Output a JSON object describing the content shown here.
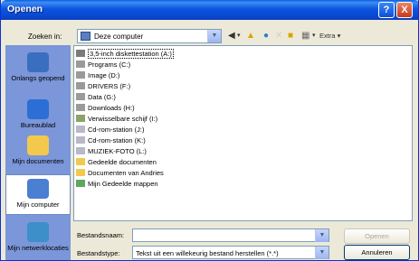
{
  "window": {
    "title": "Openen",
    "help_label": "?",
    "close_label": "X"
  },
  "lookin": {
    "label": "Zoeken in:",
    "value": "Deze computer"
  },
  "toolbar": {
    "extra_label": "Extra ▾"
  },
  "places": [
    {
      "label": "Onlangs geopend",
      "icon": "recent-icon",
      "color": "#3a6fbf"
    },
    {
      "label": "Bureaublad",
      "icon": "desktop-icon",
      "color": "#2b6fd6"
    },
    {
      "label": "Mijn documenten",
      "icon": "folder-icon",
      "color": "#f2c94c"
    },
    {
      "label": "Mijn computer",
      "icon": "computer-icon",
      "color": "#4a7fd1"
    },
    {
      "label": "Mijn netwerklocaties",
      "icon": "network-icon",
      "color": "#3c8fc8"
    }
  ],
  "files": [
    {
      "label": "3,5-inch diskettestation (A:)",
      "icon": "floppy-icon",
      "color": "#7a7a7a"
    },
    {
      "label": "Programs (C:)",
      "icon": "drive-icon",
      "color": "#9a9a9a"
    },
    {
      "label": "Image (D:)",
      "icon": "drive-icon",
      "color": "#9a9a9a"
    },
    {
      "label": "DRIVERS (F:)",
      "icon": "drive-icon",
      "color": "#9a9a9a"
    },
    {
      "label": "Data (G:)",
      "icon": "drive-icon",
      "color": "#9a9a9a"
    },
    {
      "label": "Downloads (H:)",
      "icon": "drive-icon",
      "color": "#9a9a9a"
    },
    {
      "label": "Verwisselbare schijf (I:)",
      "icon": "removable-drive-icon",
      "color": "#8aa36a"
    },
    {
      "label": "Cd-rom-station (J:)",
      "icon": "cdrom-icon",
      "color": "#b8b8c8"
    },
    {
      "label": "Cd-rom-station (K:)",
      "icon": "cdrom-icon",
      "color": "#b8b8c8"
    },
    {
      "label": "MUZIEK-FOTO (L:)",
      "icon": "cdrom-icon",
      "color": "#b8b8c8"
    },
    {
      "label": "Gedeelde documenten",
      "icon": "folder-icon",
      "color": "#f2c94c"
    },
    {
      "label": "Documenten van Andries",
      "icon": "folder-icon",
      "color": "#f2c94c"
    },
    {
      "label": "Mijn Gedeelde mappen",
      "icon": "shared-folder-icon",
      "color": "#5ea85e"
    }
  ],
  "filename": {
    "label": "Bestandsnaam:",
    "value": ""
  },
  "filetype": {
    "label": "Bestandstype:",
    "value": "Tekst uit een willekeurig bestand herstellen (*.*)"
  },
  "buttons": {
    "open": "Openen",
    "cancel": "Annuleren"
  }
}
